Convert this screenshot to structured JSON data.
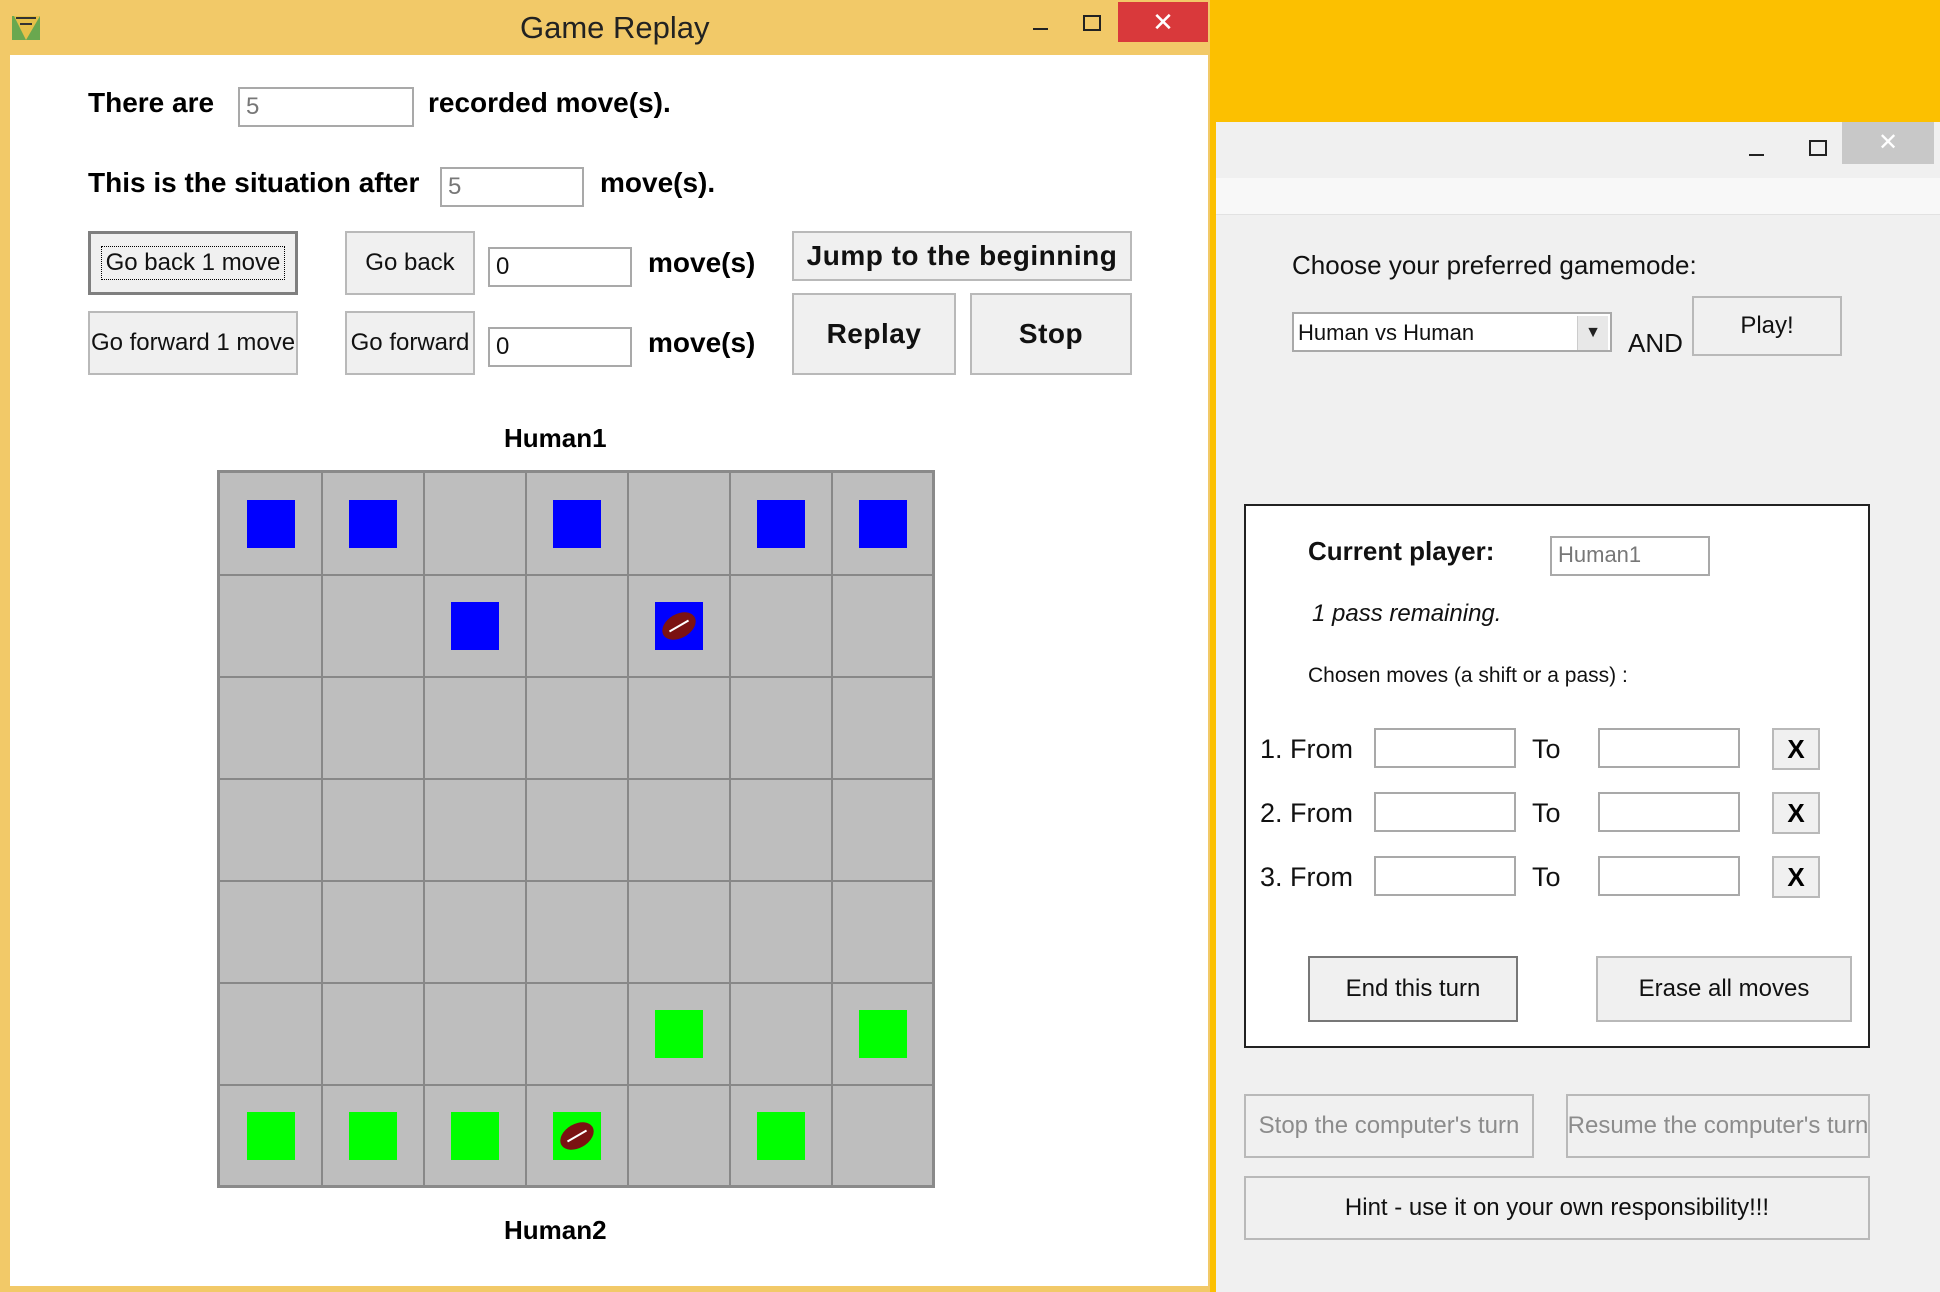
{
  "replay_window": {
    "title": "Game Replay",
    "recorded_prefix": "There are",
    "recorded_count": "5",
    "recorded_suffix": "recorded move(s).",
    "situation_prefix": "This is the situation after",
    "situation_count": "5",
    "situation_suffix": "move(s).",
    "go_back_1": "Go back 1 move",
    "go_forward_1": "Go forward 1 move",
    "go_back": "Go back",
    "go_forward": "Go forward",
    "back_count": "0",
    "forward_count": "0",
    "moves_label": "move(s)",
    "jump_beginning": "Jump to the beginning",
    "replay": "Replay",
    "stop": "Stop",
    "top_player": "Human1",
    "bottom_player": "Human2",
    "board": {
      "size": 7,
      "blue": "#0000ff",
      "green": "#00ff00",
      "blue_pieces": [
        [
          0,
          0
        ],
        [
          0,
          1
        ],
        [
          0,
          3
        ],
        [
          0,
          5
        ],
        [
          0,
          6
        ],
        [
          1,
          2
        ],
        [
          1,
          4
        ]
      ],
      "green_pieces": [
        [
          5,
          4
        ],
        [
          5,
          6
        ],
        [
          6,
          0
        ],
        [
          6,
          1
        ],
        [
          6,
          2
        ],
        [
          6,
          3
        ],
        [
          6,
          5
        ]
      ],
      "balls": [
        [
          1,
          4
        ],
        [
          6,
          3
        ]
      ]
    }
  },
  "game_window": {
    "gamemode_prompt": "Choose your preferred gamemode:",
    "gamemode_selected": "Human vs Human",
    "and_label": "AND",
    "play_button": "Play!",
    "current_player_label": "Current player:",
    "current_player_value": "Human1",
    "passes_remaining": "1 pass remaining.",
    "chosen_moves_label": "Chosen moves (a shift or a pass) :",
    "moves": [
      {
        "label": "1. From",
        "to": "To"
      },
      {
        "label": "2. From",
        "to": "To"
      },
      {
        "label": "3. From",
        "to": "To"
      }
    ],
    "clear_move": "X",
    "end_turn": "End this turn",
    "erase_moves": "Erase all moves",
    "stop_computer": "Stop the computer's turn",
    "resume_computer": "Resume the computer's turn",
    "hint": "Hint - use it on your own responsibility!!!"
  }
}
